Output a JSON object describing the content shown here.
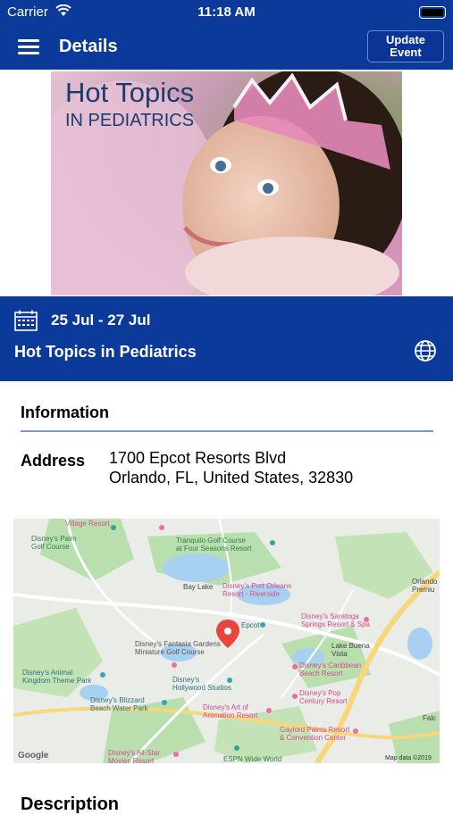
{
  "status": {
    "carrier": "Carrier",
    "time": "11:18 AM"
  },
  "nav": {
    "title": "Details",
    "update_label_line1": "Update",
    "update_label_line2": "Event"
  },
  "hero": {
    "title": "Hot Topics",
    "subtitle": "IN PEDIATRICS"
  },
  "event": {
    "dates": "25 Jul - 27 Jul",
    "title": "Hot Topics in Pediatrics"
  },
  "information": {
    "header": "Information",
    "address_label": "Address",
    "address_line1": "1700 Epcot Resorts Blvd",
    "address_line2": "Orlando, FL, United States, 32830"
  },
  "map": {
    "labels": {
      "village_resort": "Village Resort",
      "palm_golf": "Disney's Palm\nGolf Course",
      "tranquilo": "Tranquilo Golf Course\nat Four Seasons Resort",
      "orlando": "Orlando\nPremiu",
      "bay_lake": "Bay Lake",
      "port_orleans": "Disney's Port Orleans\nResort - Riverside",
      "epcot": "Epcot",
      "saratoga": "Disney's Saratoga\nSprings Resort & Spa",
      "lake_buena_vista": "Lake Buena\nVista",
      "fantasia": "Disney's Fantasia Gardens\nMiniature Golf Course",
      "caribbean": "Disney's Caribbean\nBeach Resort",
      "animal_kingdom": "Disney's Animal\nKingdom Theme Park",
      "hollywood": "Disney's\nHollywood Studios",
      "pop_century": "Disney's Pop\nCentury Resort",
      "blizzard": "Disney's Blizzard\nBeach Water Park",
      "art_animation": "Disney's Art of\nAnimation Resort",
      "gaylord": "Gaylord Palms Resort\n& Convention Center",
      "all_star": "Disney's All-Star\nMovies Resort",
      "espn": "ESPN Wide World",
      "google": "Google",
      "copyright": "Map data ©2019",
      "falc": "Falc"
    }
  },
  "description": {
    "header": "Description"
  }
}
